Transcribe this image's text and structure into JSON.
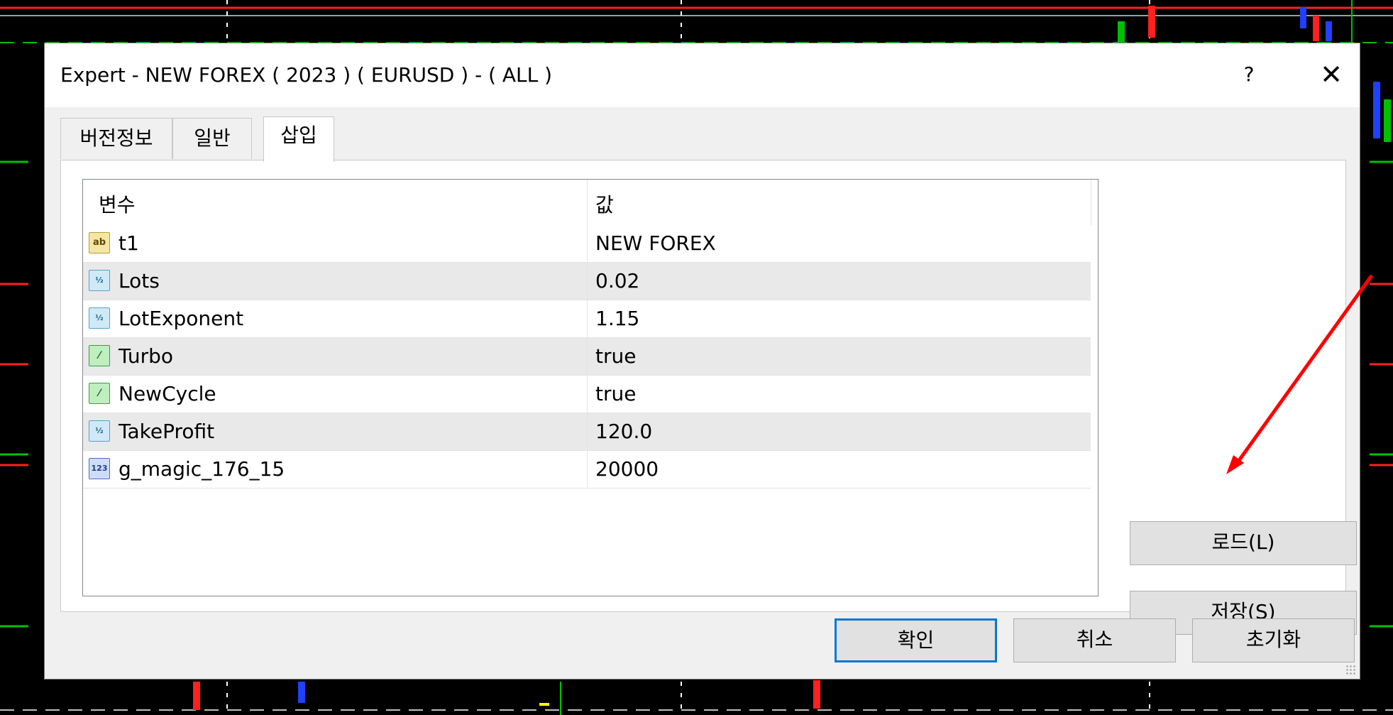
{
  "dialog": {
    "title": "Expert - NEW FOREX ( 2023 ) ( EURUSD ) - ( ALL )",
    "help_label": "?",
    "close_label": "✕"
  },
  "tabs": [
    {
      "label": "버전정보",
      "active": false
    },
    {
      "label": "일반",
      "active": false
    },
    {
      "label": "삽입",
      "active": true
    }
  ],
  "list": {
    "col_variable": "변수",
    "col_value": "값",
    "rows": [
      {
        "icon": "string-type-icon",
        "icon_text": "ab",
        "name": "t1",
        "value": "NEW FOREX"
      },
      {
        "icon": "double-type-icon",
        "icon_text": "½",
        "name": "Lots",
        "value": "0.02"
      },
      {
        "icon": "double-type-icon",
        "icon_text": "½",
        "name": "LotExponent",
        "value": "1.15"
      },
      {
        "icon": "bool-type-icon",
        "icon_text": "⁄",
        "name": "Turbo",
        "value": "true"
      },
      {
        "icon": "bool-type-icon",
        "icon_text": "⁄",
        "name": "NewCycle",
        "value": "true"
      },
      {
        "icon": "double-type-icon",
        "icon_text": "½",
        "name": "TakeProfit",
        "value": "120.0"
      },
      {
        "icon": "int-type-icon",
        "icon_text": "123",
        "name": "g_magic_176_15",
        "value": "20000"
      }
    ]
  },
  "side_buttons": {
    "load_label": "로드(L)",
    "save_label": "저장(S)"
  },
  "footer_buttons": {
    "ok_label": "확인",
    "cancel_label": "취소",
    "reset_label": "초기화"
  },
  "colors": {
    "annotation_arrow": "#ff0000",
    "default_button_border": "#0078d7"
  }
}
